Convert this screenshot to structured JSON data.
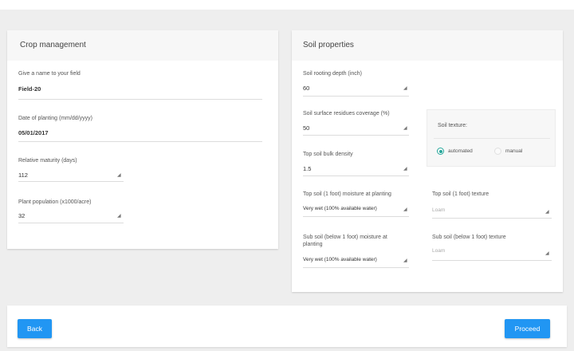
{
  "crop": {
    "title": "Crop management",
    "field_name": {
      "label": "Give a name to your field",
      "value": "Field-20"
    },
    "planting_date": {
      "label": "Date of planting (mm/dd/yyyy)",
      "value": "05/01/2017"
    },
    "maturity": {
      "label": "Relative maturity (days)",
      "value": "112"
    },
    "population": {
      "label": "Plant population (x1000/acre)",
      "value": "32"
    }
  },
  "soil": {
    "title": "Soil properties",
    "rooting_depth": {
      "label": "Soil rooting depth (inch)",
      "value": "60"
    },
    "residues": {
      "label": "Soil surface residues coverage (%)",
      "value": "50"
    },
    "bulk_density": {
      "label": "Top soil bulk density",
      "value": "1.5"
    },
    "top_moisture": {
      "label": "Top soil (1 foot) moisture at planting",
      "value": "Very wet (100% available water)"
    },
    "sub_moisture": {
      "label_line1": "Sub soil (below 1 foot) moisture at",
      "label_line2": "planting",
      "value": "Very wet (100% available water)"
    },
    "texture": {
      "label": "Soil texture:",
      "option_automated": "automated",
      "option_manual": "manual",
      "selected": "automated"
    },
    "top_texture": {
      "label": "Top soil (1 foot) texture",
      "value": "Loam"
    },
    "sub_texture": {
      "label": "Sub soil (below 1 foot) texture",
      "value": "Loam"
    }
  },
  "actions": {
    "back": "Back",
    "proceed": "Proceed"
  },
  "colors": {
    "primary": "#2196f3",
    "radio_accent": "#26a69a"
  }
}
